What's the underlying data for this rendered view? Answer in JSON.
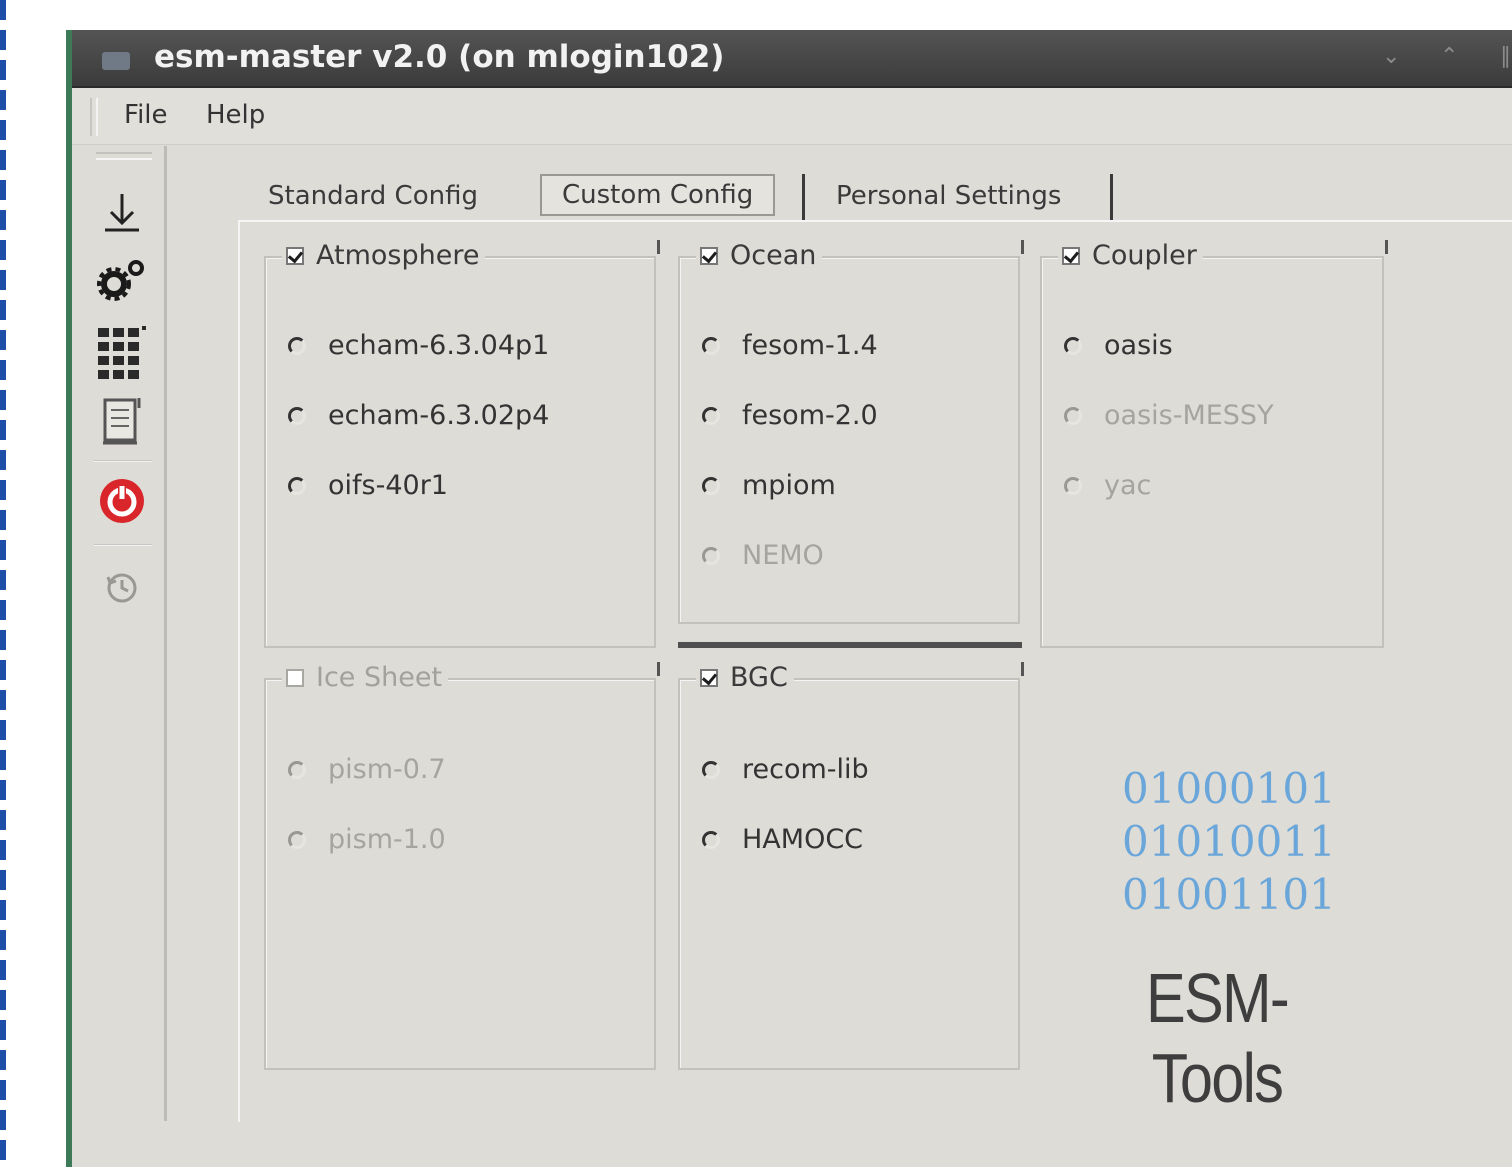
{
  "window": {
    "title": "esm-master v2.0 (on mlogin102)"
  },
  "menu": {
    "file": "File",
    "help": "Help"
  },
  "tabs": {
    "standard": "Standard Config",
    "custom": "Custom Config",
    "personal": "Personal Settings"
  },
  "groups": {
    "atmosphere": {
      "title": "Atmosphere",
      "checked": true,
      "options": [
        "echam-6.3.04p1",
        "echam-6.3.02p4",
        "oifs-40r1"
      ]
    },
    "ocean": {
      "title": "Ocean",
      "checked": true,
      "options": [
        "fesom-1.4",
        "fesom-2.0",
        "mpiom",
        "NEMO"
      ]
    },
    "coupler": {
      "title": "Coupler",
      "checked": true,
      "options": [
        "oasis",
        "oasis-MESSY",
        "yac"
      ]
    },
    "ice_sheet": {
      "title": "Ice Sheet",
      "checked": false,
      "options": [
        "pism-0.7",
        "pism-1.0"
      ]
    },
    "bgc": {
      "title": "BGC",
      "checked": true,
      "options": [
        "recom-lib",
        "HAMOCC"
      ]
    }
  },
  "logo": {
    "bits": [
      "01000101",
      "01010011",
      "01001101"
    ],
    "name": "ESM-Tools"
  },
  "colors": {
    "titlebar": "#444444",
    "window_bg": "#dedcd7",
    "logo_bits": "#6aa6d9",
    "logo_text": "#3e3e3e",
    "quit_icon": "#d9262a"
  }
}
